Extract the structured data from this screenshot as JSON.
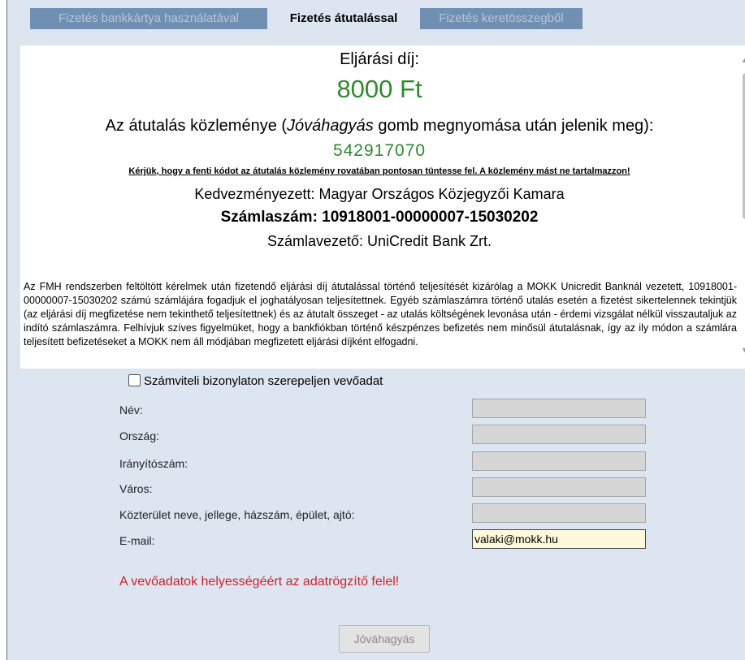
{
  "tabs": [
    {
      "label": "Fizetés bankkártya használatával"
    },
    {
      "label": "Fizetés átutalással"
    },
    {
      "label": "Fizetés keretösszegből"
    }
  ],
  "payment_info": {
    "fee_title": "Eljárási díj:",
    "fee_amount": "8000 Ft",
    "reference_title_prefix": "Az átutalás közleménye (",
    "reference_title_button": "Jóváhagyás",
    "reference_title_suffix": " gomb megnyomása után jelenik meg):",
    "reference_code": "542917070",
    "reference_note": "Kérjük, hogy a fenti kódot az átutalás közlemény rovatában pontosan tüntesse fel. A közlemény mást ne tartalmazzon!",
    "beneficiary": "Kedvezményezett: Magyar Országos Közjegyzői Kamara",
    "account_number": "Számlaszám: 10918001-00000007-15030202",
    "account_bank": "Számlavezető: UniCredit Bank Zrt."
  },
  "description": "Az FMH rendszerben feltöltött kérelmek után fizetendő eljárási díj átutalással történő teljesítését kizárólag a MOKK Unicredit Banknál vezetett, 10918001-00000007-15030202 számú számlájára fogadjuk el joghatályosan teljesítettnek. Egyéb számlaszámra történő utalás esetén a fizetést sikertelennek tekintjük (az eljárási díj megfizetése nem tekinthető teljesítettnek) és az átutalt összeget - az utalás költségének levonása után - érdemi vizsgálat nélkül visszautaljuk az indító számlaszámra. Felhívjuk szíves figyelmüket, hogy a bankfiókban történő készpénzes befizetés nem minősül átutalásnak, így az ily módon a számlára teljesített befizetéseket a MOKK nem áll módjában megfizetett eljárási díjként elfogadni.",
  "buyer_form": {
    "checkbox_label": "Számviteli bizonylaton szerepeljen vevőadat",
    "checkbox_checked": false,
    "fields": [
      {
        "label": "Név:",
        "value": ""
      },
      {
        "label": "Ország:",
        "value": ""
      },
      {
        "label": "Irányítószám:",
        "value": ""
      },
      {
        "label": "Város:",
        "value": ""
      },
      {
        "label": "Közterület neve, jellege, házszám, épület, ajtó:",
        "value": ""
      },
      {
        "label": "E-mail:",
        "value": "valaki@mokk.hu"
      }
    ],
    "warning": "A vevőadatok helyességéért az adatrögzítő felel!",
    "confirm_button": "Jóváhagyás"
  },
  "colors": {
    "panel_bg": "#dde5f1",
    "inactive_tab_bg": "#6f8fb3",
    "fee_green": "#2e8b2e",
    "warning_red": "#d0202a",
    "active_input_bg": "#fff8dc"
  },
  "icons": {
    "scroll_up": "triangle-up",
    "scroll_down": "triangle-down"
  }
}
